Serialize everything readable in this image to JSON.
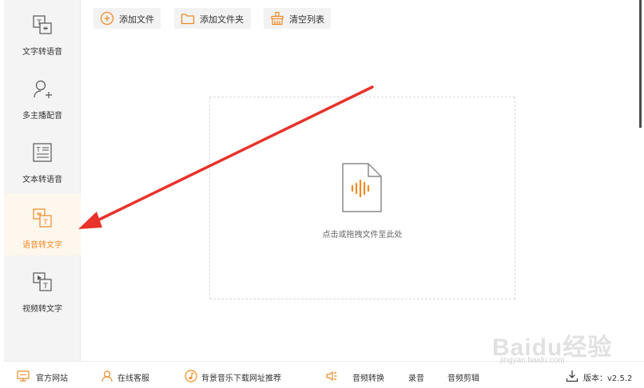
{
  "sidebar": {
    "items": [
      {
        "label": "文字转语音",
        "icon": "text-to-speech-icon",
        "active": false
      },
      {
        "label": "多主播配音",
        "icon": "user-add-icon",
        "active": false
      },
      {
        "label": "文本转语音",
        "icon": "document-text-icon",
        "active": false
      },
      {
        "label": "语音转文字",
        "icon": "speech-to-text-icon",
        "active": true
      },
      {
        "label": "视频转文字",
        "icon": "video-to-text-icon",
        "active": false
      }
    ]
  },
  "toolbar": {
    "add_file_label": "添加文件",
    "add_folder_label": "添加文件夹",
    "clear_list_label": "清空列表"
  },
  "dropzone": {
    "hint": "点击或拖拽文件至此处"
  },
  "footer": {
    "website_label": "官方网站",
    "service_label": "在线客服",
    "bgm_label": "背景音乐下载网址推荐",
    "audio_convert_label": "音频转换",
    "record_label": "录音",
    "audio_edit_label": "音频剪辑",
    "version_label": "版本：v2.5.2"
  },
  "colors": {
    "accent": "#f08a24",
    "arrow": "#e8322a",
    "sidebar_bg": "#f4f4f4"
  },
  "watermark": {
    "logo": "Baidu经验",
    "url": "jingyan.baidu.com"
  }
}
